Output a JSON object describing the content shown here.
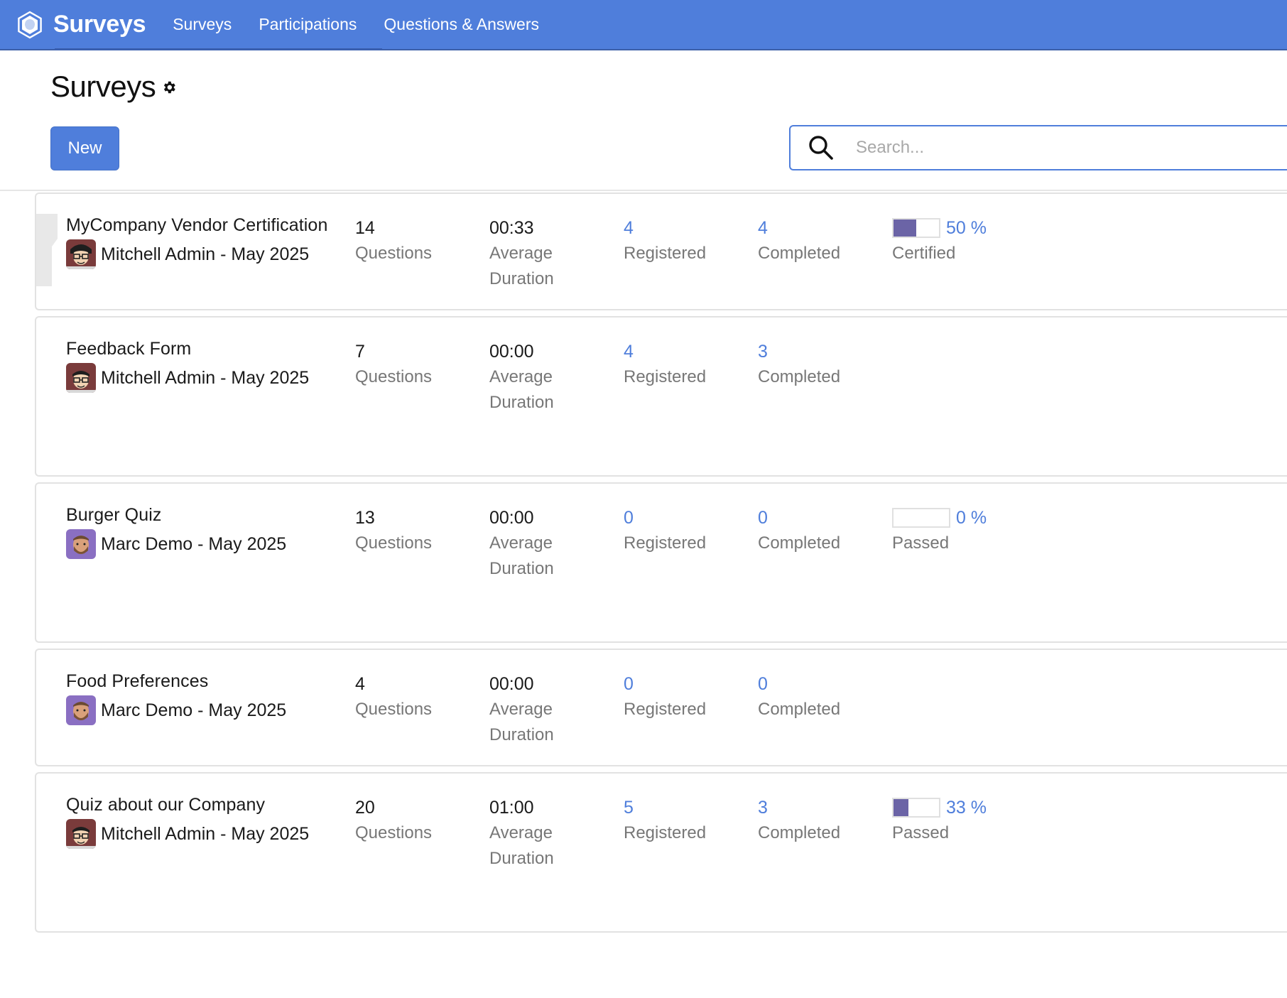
{
  "navbar": {
    "brand": "Surveys",
    "items": [
      "Surveys",
      "Participations",
      "Questions & Answers"
    ]
  },
  "control_panel": {
    "title": "Surveys",
    "new_label": "New",
    "search_placeholder": "Search..."
  },
  "colors": {
    "brand": "#4f7edb",
    "progress": "#6b64a6",
    "link": "#4f7edb"
  },
  "surveys": [
    {
      "title": "MyCompany Vendor Certification",
      "owner": "Mitchell Admin - May 2025",
      "avatar": "mitchell",
      "questions": "14",
      "questions_label": "Questions",
      "duration": "00:33",
      "duration_label_1": "Average",
      "duration_label_2": "Duration",
      "registered": "4",
      "registered_label": "Registered",
      "completed": "4",
      "completed_label": "Completed",
      "rate": "50 %",
      "rate_value": 50,
      "rate_label": "Certified",
      "certification": true
    },
    {
      "title": "Feedback Form",
      "owner": "Mitchell Admin - May 2025",
      "avatar": "mitchell",
      "questions": "7",
      "questions_label": "Questions",
      "duration": "00:00",
      "duration_label_1": "Average",
      "duration_label_2": "Duration",
      "registered": "4",
      "registered_label": "Registered",
      "completed": "3",
      "completed_label": "Completed"
    },
    {
      "title": "Burger Quiz",
      "owner": "Marc Demo - May 2025",
      "avatar": "marc",
      "questions": "13",
      "questions_label": "Questions",
      "duration": "00:00",
      "duration_label_1": "Average",
      "duration_label_2": "Duration",
      "registered": "0",
      "registered_label": "Registered",
      "completed": "0",
      "completed_label": "Completed",
      "rate": "0 %",
      "rate_value": 0,
      "rate_label": "Passed"
    },
    {
      "title": "Food Preferences",
      "owner": "Marc Demo - May 2025",
      "avatar": "marc",
      "questions": "4",
      "questions_label": "Questions",
      "duration": "00:00",
      "duration_label_1": "Average",
      "duration_label_2": "Duration",
      "registered": "0",
      "registered_label": "Registered",
      "completed": "0",
      "completed_label": "Completed"
    },
    {
      "title": "Quiz about our Company",
      "owner": "Mitchell Admin - May 2025",
      "avatar": "mitchell",
      "questions": "20",
      "questions_label": "Questions",
      "duration": "01:00",
      "duration_label_1": "Average",
      "duration_label_2": "Duration",
      "registered": "5",
      "registered_label": "Registered",
      "completed": "3",
      "completed_label": "Completed",
      "rate": "33 %",
      "rate_value": 33,
      "rate_label": "Passed"
    }
  ]
}
